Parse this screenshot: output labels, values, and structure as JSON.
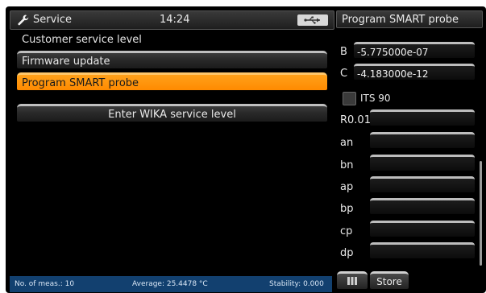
{
  "header": {
    "title": "Service",
    "time": "14:24",
    "left_icon": "wrench-icon",
    "usb_icon": "usb-icon"
  },
  "main": {
    "section_label": "Customer service level",
    "menu": [
      {
        "label": "Firmware update",
        "selected": false
      },
      {
        "label": "Program SMART probe",
        "selected": true
      }
    ],
    "wika_button": "Enter WIKA service level"
  },
  "statusbar": {
    "meas": "No. of meas.: 10",
    "average": "Average: 25.4478 °C",
    "stability": "Stability: 0.000"
  },
  "right_panel": {
    "title": "Program SMART probe",
    "B_label": "B",
    "B_value": "-5.775000e-07",
    "C_label": "C",
    "C_value": "-4.183000e-12",
    "its90_label": "ITS 90",
    "its90_checked": false,
    "fields": [
      {
        "label": "R0.01",
        "value": ""
      },
      {
        "label": "an",
        "value": ""
      },
      {
        "label": "bn",
        "value": ""
      },
      {
        "label": "ap",
        "value": ""
      },
      {
        "label": "bp",
        "value": ""
      },
      {
        "label": "cp",
        "value": ""
      },
      {
        "label": "dp",
        "value": ""
      }
    ],
    "store_label": "Store"
  },
  "colors": {
    "accent": "#ff8a00",
    "statusbar": "#12406f",
    "background": "#000000"
  }
}
